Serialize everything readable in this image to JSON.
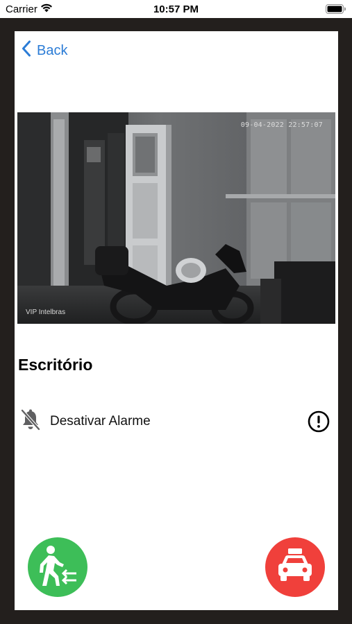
{
  "status_bar": {
    "carrier": "Carrier",
    "time": "10:57 PM"
  },
  "nav": {
    "back_label": "Back"
  },
  "camera": {
    "timestamp": "09-04-2022 22:57:07",
    "watermark": "VIP Intelbras"
  },
  "room": {
    "title": "Escritório"
  },
  "alarm": {
    "label": "Desativar Alarme"
  },
  "colors": {
    "accent": "#2b7cd6",
    "exit_button": "#3dbe58",
    "taxi_button": "#f0403b",
    "frame": "#231f1d"
  },
  "icons": {
    "back": "chevron-left-icon",
    "alarm": "bell-off-icon",
    "info": "exclamation-circle-icon",
    "exit": "walking-exit-icon",
    "taxi": "taxi-icon"
  }
}
